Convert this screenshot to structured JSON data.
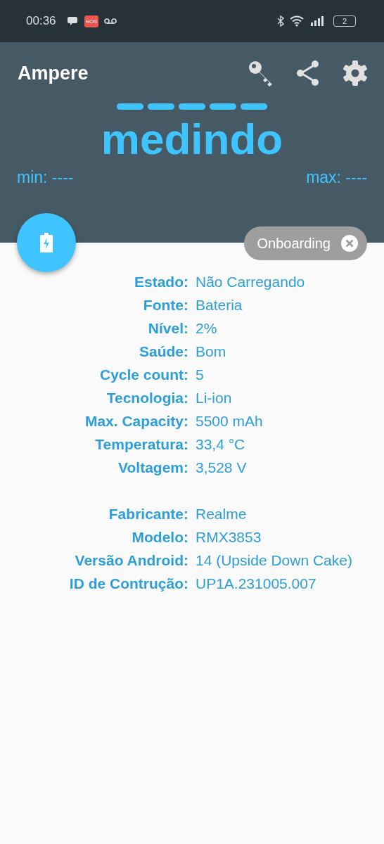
{
  "status_bar": {
    "time": "00:36",
    "sos": "SOS",
    "battery": "2"
  },
  "app_bar": {
    "title": "Ampere"
  },
  "reading": {
    "status": "medindo",
    "min": "min: ----",
    "max": "max: ----"
  },
  "chip": {
    "label": "Onboarding"
  },
  "groups": [
    [
      {
        "label": "Estado:",
        "value": "Não Carregando"
      },
      {
        "label": "Fonte:",
        "value": "Bateria"
      },
      {
        "label": "Nível:",
        "value": "2%"
      },
      {
        "label": "Saúde:",
        "value": "Bom"
      },
      {
        "label": "Cycle count:",
        "value": "5"
      },
      {
        "label": "Tecnologia:",
        "value": "Li-ion"
      },
      {
        "label": "Max. Capacity:",
        "value": "5500 mAh"
      },
      {
        "label": "Temperatura:",
        "value": "33,4 °C"
      },
      {
        "label": "Voltagem:",
        "value": "3,528 V"
      }
    ],
    [
      {
        "label": "Fabricante:",
        "value": "Realme"
      },
      {
        "label": "Modelo:",
        "value": "RMX3853"
      },
      {
        "label": "Versão Android:",
        "value": "14 (Upside Down Cake)"
      },
      {
        "label": "ID de Contrução:",
        "value": "UP1A.231005.007"
      }
    ]
  ]
}
